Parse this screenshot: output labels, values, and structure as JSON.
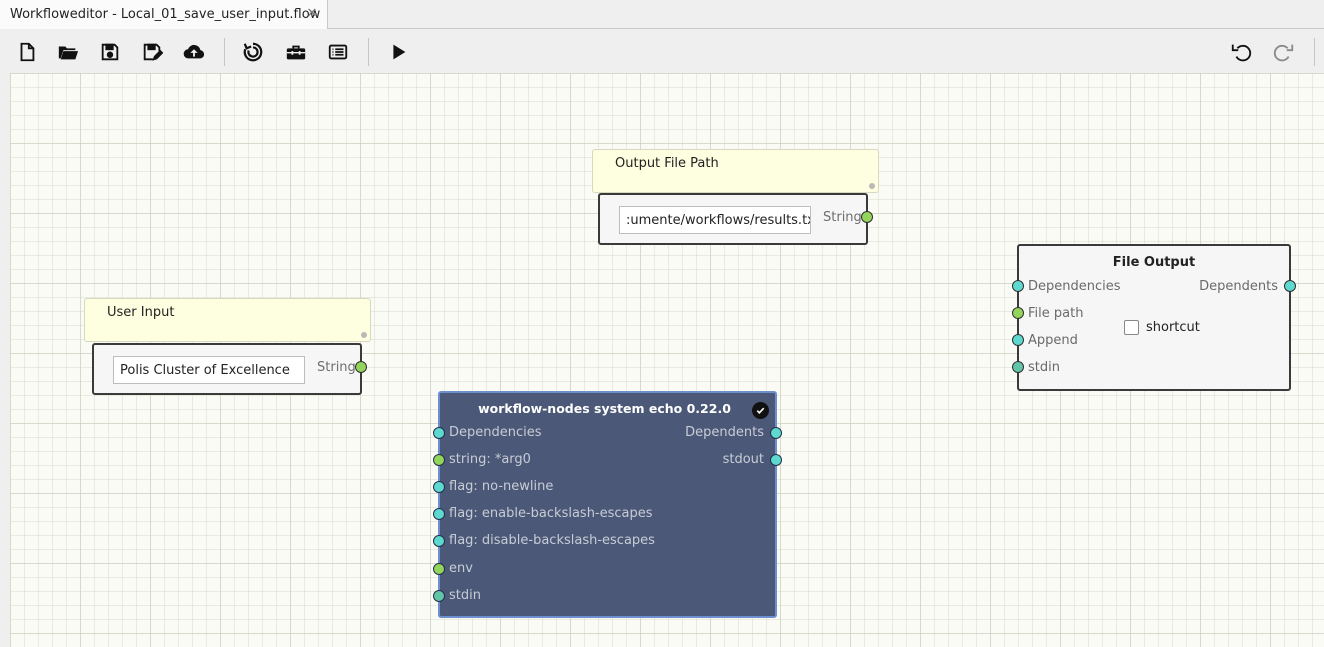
{
  "tab": {
    "title": "Workfloweditor - Local_01_save_user_input.flow",
    "close_glyph": "✕"
  },
  "toolbar": {
    "icons": [
      "new-file-icon",
      "open-folder-icon",
      "save-icon",
      "save-as-icon",
      "upload-cloud-icon",
      "layout-icon",
      "toolbox-icon",
      "list-icon",
      "run-icon",
      "undo-icon",
      "redo-icon"
    ]
  },
  "nodes": {
    "output_path_note": {
      "title": "Output File Path"
    },
    "output_path_string": {
      "value": ":umente/workflows/results.txt",
      "type_label": "String"
    },
    "user_input_note": {
      "title": "User Input"
    },
    "user_input_string": {
      "value": "Polis Cluster of Excellence",
      "type_label": "String"
    },
    "file_output": {
      "title": "File Output",
      "inputs": [
        "Dependencies",
        "File path",
        "Append",
        "stdin"
      ],
      "outputs": [
        "Dependents"
      ],
      "checkbox_label": "shortcut",
      "checkbox_checked": false
    },
    "echo": {
      "title": "workflow-nodes system echo 0.22.0",
      "inputs": [
        "Dependencies",
        "string: *arg0",
        "flag: no-newline",
        "flag: enable-backslash-escapes",
        "flag: disable-backslash-escapes",
        "env",
        "stdin"
      ],
      "outputs": [
        "Dependents",
        "stdout"
      ]
    }
  },
  "colors": {
    "port_cyan": "#5ed9cf",
    "port_green": "#93d45a",
    "port_teal": "#61c6a8",
    "echo_node_bg": "#4b5877",
    "echo_node_border": "#6d8fd0",
    "note_bg": "#fefee0"
  }
}
